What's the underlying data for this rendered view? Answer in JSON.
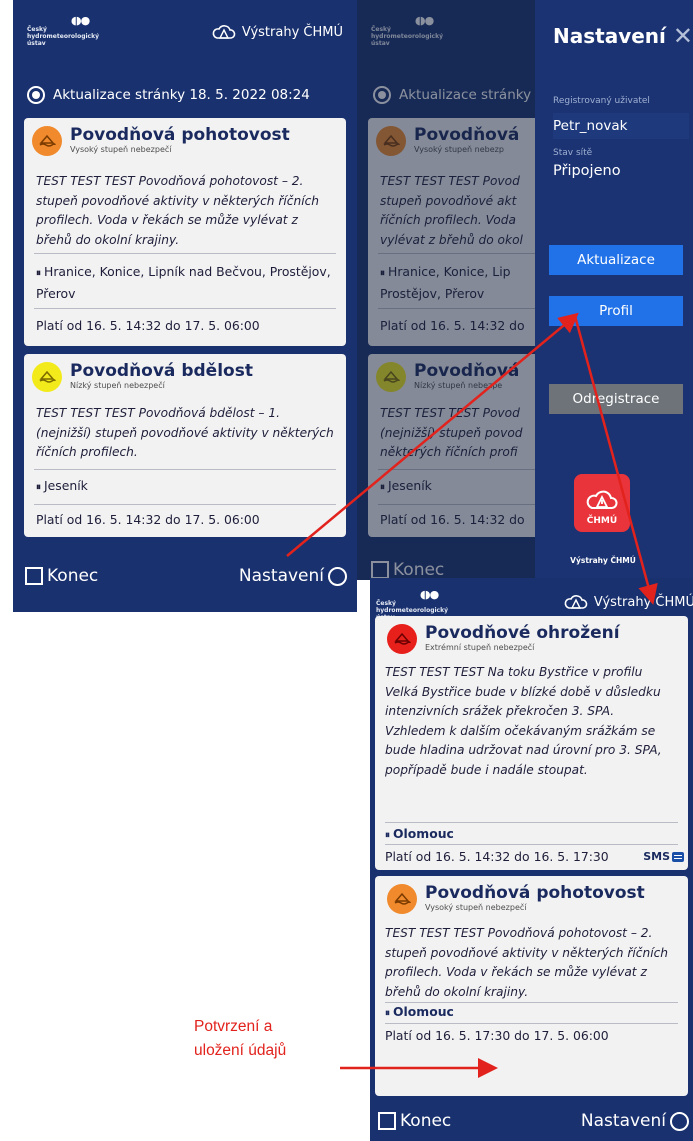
{
  "header": {
    "org_name": "Český\nhydrometeorologický\nústav",
    "brand": "Výstrahy ČHMÚ"
  },
  "update": {
    "text": "Aktualizace stránky 18. 5. 2022 08:24",
    "text_cropped": "Aktualizace stránky"
  },
  "screen1": {
    "cards": [
      {
        "title": "Povodňová pohotovost",
        "subtitle": "Vysoký stupeň nebezpečí",
        "description": "TEST TEST TEST Povodňová pohotovost – 2. stupeň povodňové aktivity v některých říčních profilech. Voda v řekách se může vylévat z břehů do okolní krajiny.",
        "locations": "Hranice, Konice, Lipník nad Bečvou, Prostějov, Přerov",
        "validity": "Platí od 16. 5. 14:32 do 17. 5. 06:00",
        "level_color": "#f08a2c"
      },
      {
        "title": "Povodňová bdělost",
        "subtitle": "Nízký stupeň nebezpečí",
        "description": "TEST TEST TEST Povodňová bdělost – 1. (nejnižší) stupeň povodňové aktivity v některých říčních profilech.",
        "locations": "Jeseník",
        "validity": "Platí od 16. 5. 14:32 do 17. 5. 06:00",
        "level_color": "#f2ea1a"
      }
    ]
  },
  "screen2": {
    "cards": [
      {
        "title_cropped": "Povodňová",
        "subtitle_cropped": "Vysoký stupeň nebezp",
        "description_lines": [
          "TEST TEST TEST Povod",
          "stupeň povodňové akt",
          "říčních profilech. Voda",
          "vylévat z břehů do okol"
        ],
        "locations_lines": [
          "Hranice, Konice, Lip",
          "Prostějov, Přerov"
        ],
        "validity": "Platí od 16. 5. 14:32 do"
      },
      {
        "title_cropped": "Povodňová",
        "subtitle_cropped": "Nízký stupeň nebezpe",
        "description_lines": [
          "TEST TEST TEST Povod",
          "(nejnižší) stupeň povod",
          "některých říčních profi"
        ],
        "locations": "Jeseník",
        "validity": "Platí od 16. 5. 14:32 do"
      }
    ],
    "footer_left_cropped": "Konec"
  },
  "drawer": {
    "title": "Nastavení",
    "close_icon": "close-icon",
    "user_label": "Registrovaný uživatel",
    "user_value": "Petr_novak",
    "network_label": "Stav sítě",
    "network_value": "Připojeno",
    "update_button": "Aktualizace",
    "profile_button": "Profil",
    "unregister_button": "Odregistrace",
    "app_tile_text": "ČHMÚ",
    "app_caption": "Výstrahy ČHMÚ"
  },
  "screen3": {
    "cards": [
      {
        "title": "Povodňové ohrožení",
        "subtitle": "Extrémní stupeň nebezpečí",
        "description": "TEST TEST TEST Na toku Bystřice v profilu Velká Bystřice bude v blízké době v důsledku intenzivních srážek překročen 3. SPA. Vzhledem k dalším očekávaným srážkám se bude hladina udržovat nad úrovní pro 3. SPA, popřípadě bude i nadále stoupat.",
        "locations": "Olomouc",
        "validity": "Platí od 16. 5. 14:32 do 16. 5. 17:30",
        "sms": "SMS",
        "level_color": "#e8201c"
      },
      {
        "title": "Povodňová pohotovost",
        "subtitle": "Vysoký stupeň nebezpečí",
        "description": "TEST TEST TEST Povodňová pohotovost – 2. stupeň povodňové aktivity v některých říčních profilech. Voda v řekách se může vylévat z břehů do okolní krajiny.",
        "locations": "Olomouc",
        "validity": "Platí od 16. 5. 17:30 do 17. 5. 06:00",
        "level_color": "#f08a2c"
      }
    ]
  },
  "footer": {
    "exit_label": "Konec",
    "settings_label": "Nastavení"
  },
  "annotation": {
    "text_line1": "Potvrzení a",
    "text_line2": "uložení údajů",
    "color": "#e2221c"
  }
}
